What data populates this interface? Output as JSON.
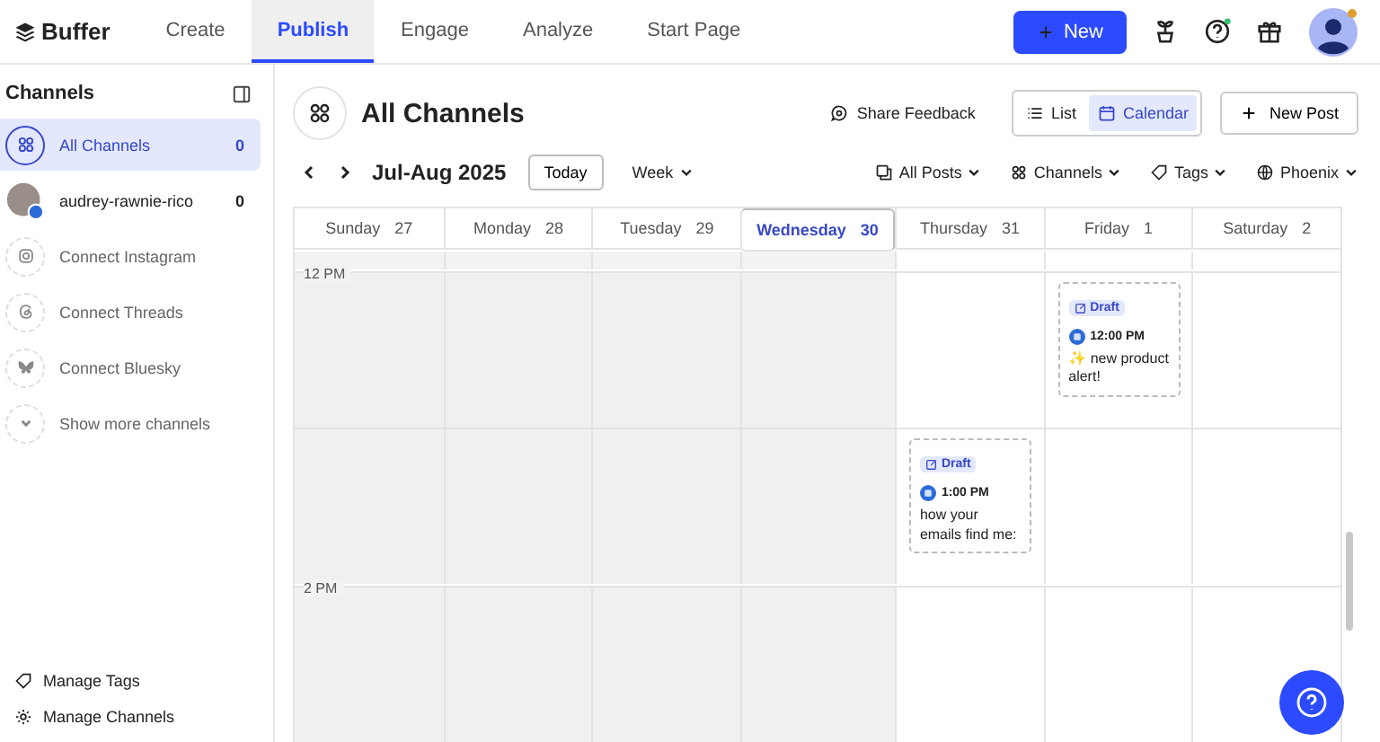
{
  "top_nav": {
    "logo": "Buffer",
    "tabs": [
      {
        "label": "Create",
        "selected": false
      },
      {
        "label": "Publish",
        "selected": true
      },
      {
        "label": "Engage",
        "selected": false
      },
      {
        "label": "Analyze",
        "selected": false
      },
      {
        "label": "Start Page",
        "selected": false
      }
    ],
    "new_button": "New"
  },
  "sidebar": {
    "title": "Channels",
    "items": [
      {
        "kind": "all",
        "label": "All Channels",
        "count": "0",
        "selected": true
      },
      {
        "kind": "account",
        "label": "audrey-rawnie-rico",
        "count": "0",
        "selected": false
      },
      {
        "kind": "instagram",
        "label": "Connect Instagram",
        "selected": false
      },
      {
        "kind": "threads",
        "label": "Connect Threads",
        "selected": false
      },
      {
        "kind": "bluesky",
        "label": "Connect Bluesky",
        "selected": false
      },
      {
        "kind": "more",
        "label": "Show more channels",
        "selected": false
      }
    ],
    "footer": [
      {
        "kind": "tags",
        "label": "Manage Tags"
      },
      {
        "kind": "settings",
        "label": "Manage Channels"
      }
    ]
  },
  "header": {
    "title": "All Channels",
    "feedback": "Share Feedback",
    "views": [
      {
        "kind": "list",
        "label": "List",
        "selected": false
      },
      {
        "kind": "calendar",
        "label": "Calendar",
        "selected": true
      }
    ],
    "new_post": "New Post"
  },
  "toolbar": {
    "range": "Jul-Aug 2025",
    "today": "Today",
    "period": "Week",
    "filters": [
      {
        "kind": "posts",
        "label": "All Posts"
      },
      {
        "kind": "channels",
        "label": "Channels"
      },
      {
        "kind": "tags",
        "label": "Tags"
      },
      {
        "kind": "timezone",
        "label": "Phoenix"
      }
    ]
  },
  "calendar": {
    "days": [
      {
        "name": "Sunday",
        "date": "27",
        "past": true,
        "today": false
      },
      {
        "name": "Monday",
        "date": "28",
        "past": true,
        "today": false
      },
      {
        "name": "Tuesday",
        "date": "29",
        "past": true,
        "today": false
      },
      {
        "name": "Wednesday",
        "date": "30",
        "past": true,
        "today": true
      },
      {
        "name": "Thursday",
        "date": "31",
        "past": false,
        "today": false
      },
      {
        "name": "Friday",
        "date": "1",
        "past": false,
        "today": false
      },
      {
        "name": "Saturday",
        "date": "2",
        "past": false,
        "today": false
      }
    ],
    "rows": [
      {
        "label": "12 PM",
        "cells": [
          {},
          {},
          {},
          {},
          {},
          {
            "posts": [
              {
                "status": "Draft",
                "time": "12:00 PM",
                "text": "✨ new product alert!"
              }
            ]
          },
          {}
        ]
      },
      {
        "cells": [
          {},
          {},
          {},
          {},
          {
            "posts": [
              {
                "status": "Draft",
                "time": "1:00 PM",
                "text": "how your emails find me:"
              }
            ]
          },
          {},
          {}
        ]
      },
      {
        "label": "2 PM",
        "cells": [
          {},
          {},
          {},
          {},
          {},
          {},
          {}
        ]
      }
    ]
  }
}
